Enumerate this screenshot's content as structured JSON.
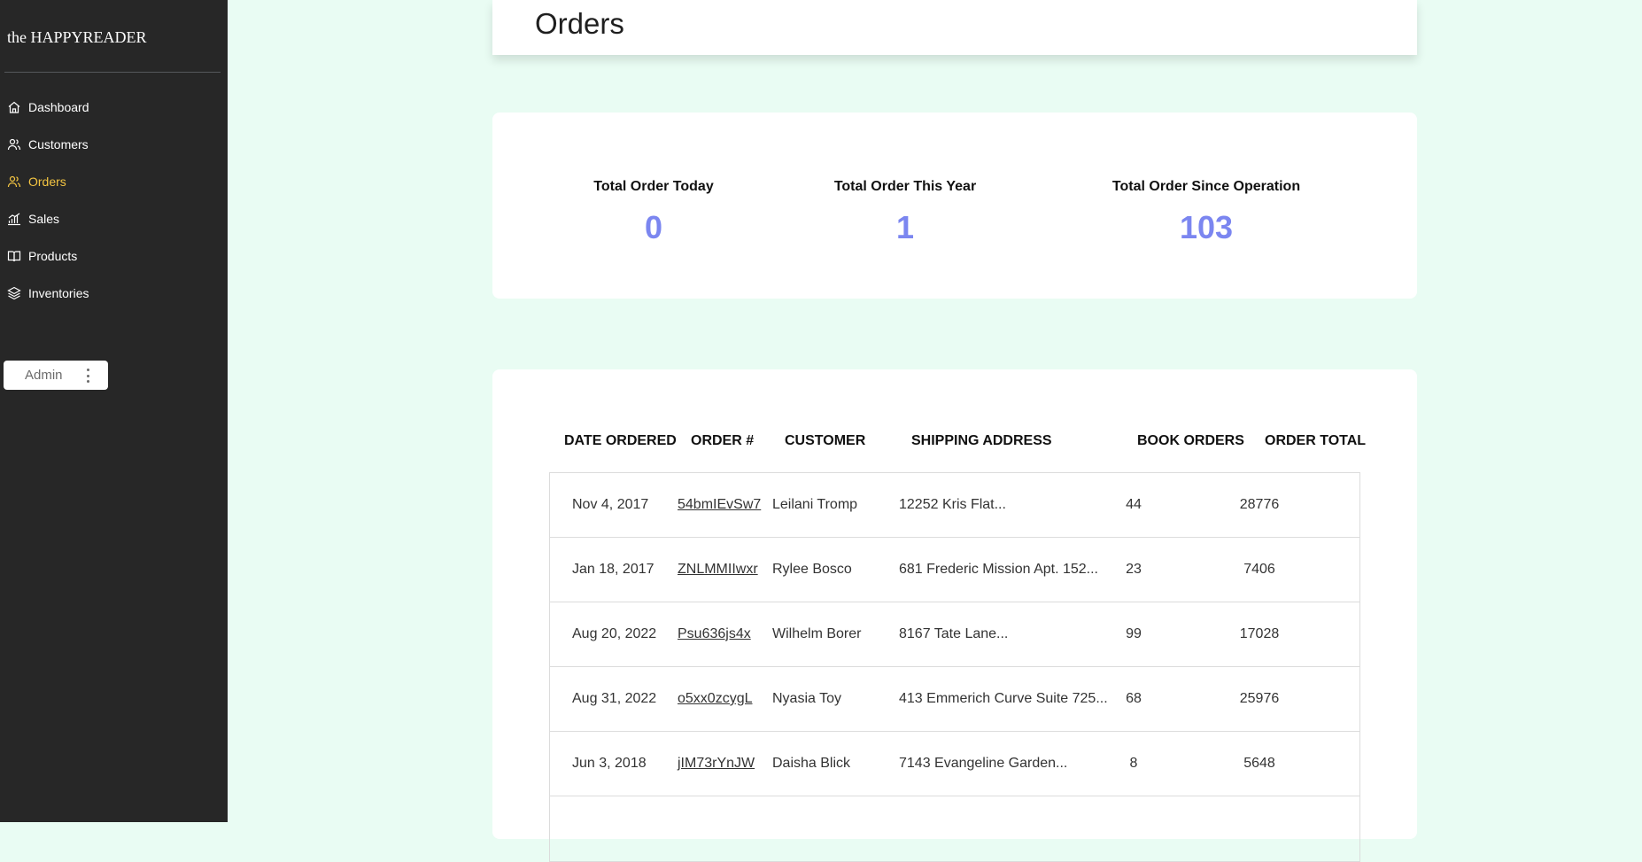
{
  "sidebar": {
    "brand": "the HAPPYREADER",
    "items": [
      {
        "label": "Dashboard",
        "icon": "home-icon",
        "active": false
      },
      {
        "label": "Customers",
        "icon": "users-icon",
        "active": false
      },
      {
        "label": "Orders",
        "icon": "users-icon",
        "active": true
      },
      {
        "label": "Sales",
        "icon": "bar-chart-icon",
        "active": false
      },
      {
        "label": "Products",
        "icon": "book-icon",
        "active": false
      },
      {
        "label": "Inventories",
        "icon": "layers-icon",
        "active": false
      }
    ],
    "admin_label": "Admin"
  },
  "header": {
    "title": "Orders"
  },
  "stats": [
    {
      "label": "Total Order Today",
      "value": "0"
    },
    {
      "label": "Total Order This Year",
      "value": "1"
    },
    {
      "label": "Total Order Since Operation",
      "value": "103"
    }
  ],
  "table": {
    "columns": [
      "DATE ORDERED",
      "ORDER #",
      "CUSTOMER",
      "SHIPPING ADDRESS",
      "BOOK ORDERS",
      "ORDER TOTAL"
    ],
    "rows": [
      {
        "date": "Nov 4, 2017",
        "order": "54bmIEvSw7",
        "customer": "Leilani Tromp",
        "address": "12252 Kris Flat...",
        "books": "44",
        "total": "28776"
      },
      {
        "date": "Jan 18, 2017",
        "order": "ZNLMMIIwxr",
        "customer": "Rylee Bosco",
        "address": "681 Frederic Mission Apt. 152...",
        "books": "23",
        "total": "7406"
      },
      {
        "date": "Aug 20, 2022",
        "order": "Psu636js4x",
        "customer": "Wilhelm Borer",
        "address": "8167 Tate Lane...",
        "books": "99",
        "total": "17028"
      },
      {
        "date": "Aug 31, 2022",
        "order": "o5xx0zcygL",
        "customer": "Nyasia Toy",
        "address": "413 Emmerich Curve Suite 725...",
        "books": "68",
        "total": "25976"
      },
      {
        "date": "Jun 3, 2018",
        "order": "jIM73rYnJW",
        "customer": "Daisha Blick",
        "address": "7143 Evangeline Garden...",
        "books": "8",
        "total": "5648"
      }
    ]
  },
  "colors": {
    "sidebar_bg": "#272727",
    "active_nav": "#f4c542",
    "stat_value": "#7b86f0",
    "page_bg": "#e9fcf3"
  }
}
